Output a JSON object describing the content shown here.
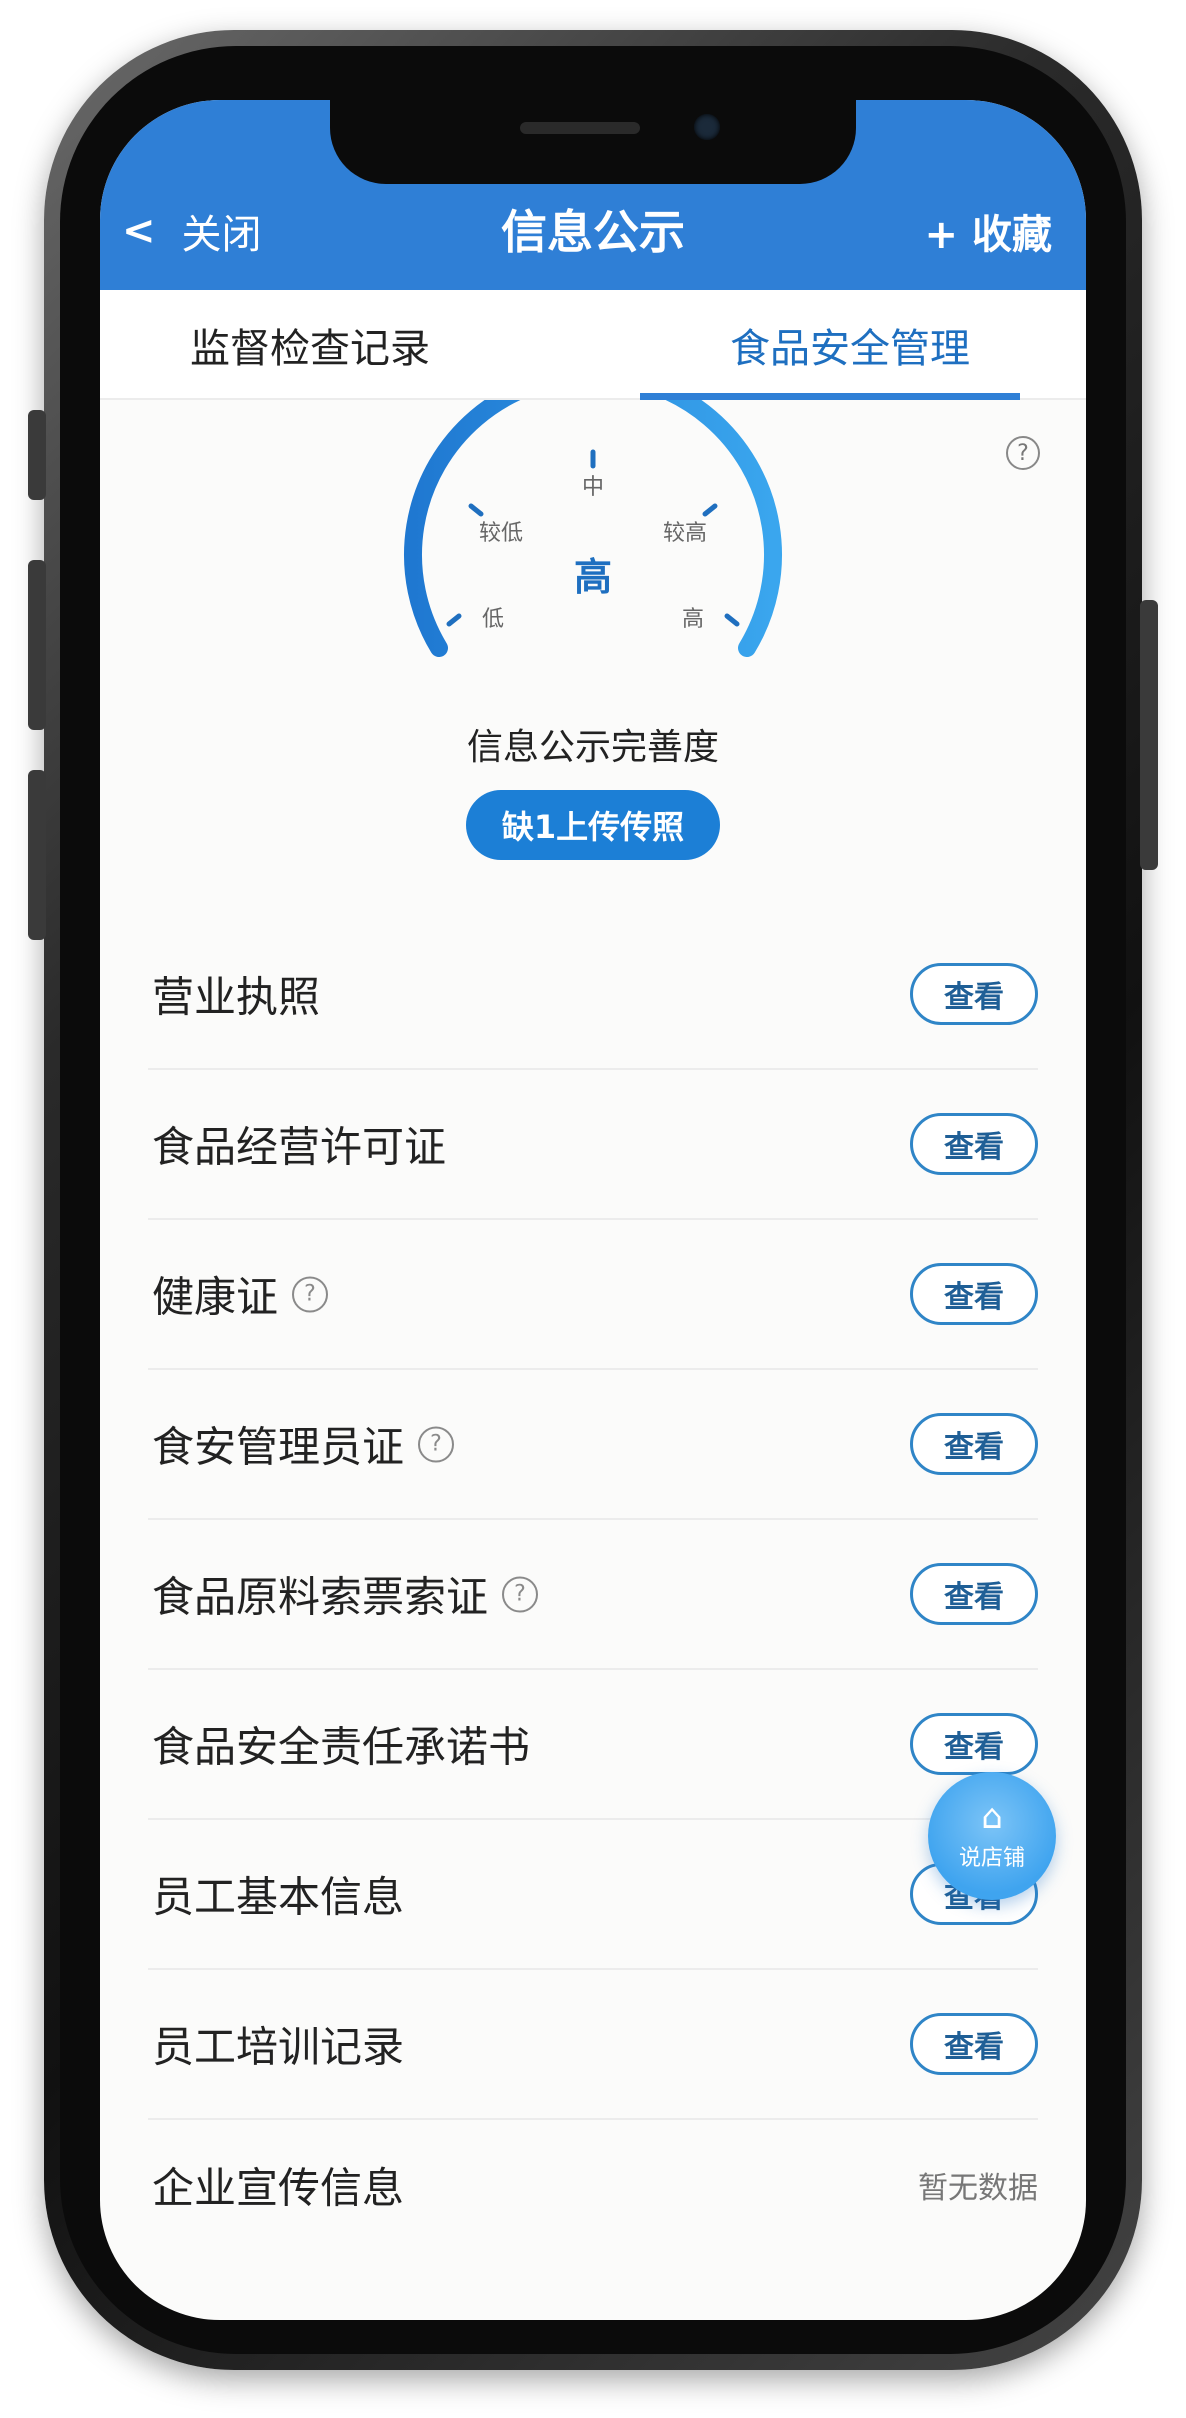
{
  "header": {
    "close_label": "关闭",
    "title": "信息公示",
    "favorite_label": "+ 收藏",
    "accent_color": "#2f7fd6"
  },
  "tabs": [
    {
      "label": "监督检查记录",
      "active": false
    },
    {
      "label": "食品安全管理",
      "active": true
    }
  ],
  "gauge": {
    "levels": [
      "低",
      "较低",
      "中",
      "较高",
      "高"
    ],
    "current_level": "高",
    "caption": "信息公示完善度",
    "missing_button": "缺1上传传照",
    "help_icon": "?"
  },
  "list": {
    "view_label": "查看",
    "nodata_label": "暂无数据",
    "items": [
      {
        "label": "营业执照",
        "help": false,
        "status": "view"
      },
      {
        "label": "食品经营许可证",
        "help": false,
        "status": "view"
      },
      {
        "label": "健康证",
        "help": true,
        "status": "view"
      },
      {
        "label": "食安管理员证",
        "help": true,
        "status": "view"
      },
      {
        "label": "食品原料索票索证",
        "help": true,
        "status": "view"
      },
      {
        "label": "食品安全责任承诺书",
        "help": false,
        "status": "view"
      },
      {
        "label": "员工基本信息",
        "help": false,
        "status": "view"
      },
      {
        "label": "员工培训记录",
        "help": false,
        "status": "view"
      },
      {
        "label": "企业宣传信息",
        "help": false,
        "status": "nodata"
      }
    ]
  },
  "floating_button": {
    "label": "说店铺",
    "icon": "home-icon"
  }
}
